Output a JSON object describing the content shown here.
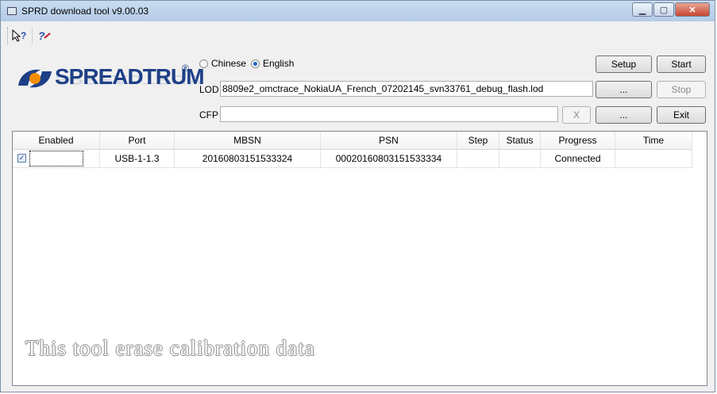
{
  "window": {
    "title": "SPRD download tool v9.00.03"
  },
  "logo": {
    "text": "SPREADTRUM",
    "reg": "®"
  },
  "language": {
    "chinese_label": "Chinese",
    "english_label": "English",
    "selected": "English"
  },
  "lod": {
    "label": "LOD",
    "value": "8809e2_omctrace_NokiaUA_French_07202145_svn33761_debug_flash.lod",
    "browse_label": "..."
  },
  "cfp": {
    "label": "CFP",
    "value": "",
    "clear_label": "X",
    "browse_label": "..."
  },
  "buttons": {
    "setup": "Setup",
    "start": "Start",
    "stop": "Stop",
    "exit": "Exit"
  },
  "table": {
    "columns": [
      "Enabled",
      "Port",
      "MBSN",
      "PSN",
      "Step",
      "Status",
      "Progress",
      "Time"
    ],
    "rows": [
      {
        "enabled": true,
        "port": "USB-1-1.3",
        "mbsn": "20160803151533324",
        "psn": "00020160803151533334",
        "step": "",
        "status": "",
        "progress": "Connected",
        "time": ""
      }
    ]
  },
  "watermark": "This tool erase calibration data"
}
